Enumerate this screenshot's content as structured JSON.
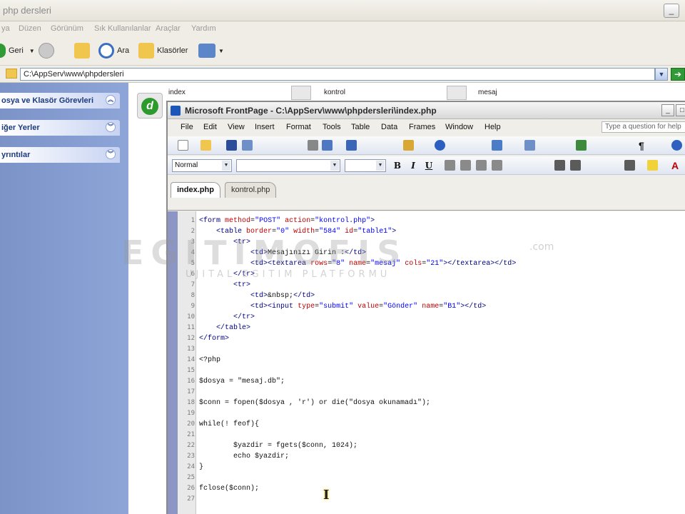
{
  "explorer": {
    "title": "php dersleri",
    "menu": [
      "ya",
      "Düzen",
      "Görünüm",
      "Sık Kullanılanlar",
      "Araçlar",
      "Yardım"
    ],
    "toolbar": {
      "back": "Geri",
      "search": "Ara",
      "folders": "Klasörler"
    },
    "address": "C:\\AppServ\\www\\phpdersleri",
    "left_panels": [
      "osya ve Klasör Görevleri",
      "iğer Yerler",
      "yrıntılar"
    ],
    "files": [
      "index",
      "kontrol",
      "mesaj"
    ]
  },
  "frontpage": {
    "title": "Microsoft FrontPage - C:\\AppServ\\www\\phpdersleri\\index.php",
    "menu": [
      "File",
      "Edit",
      "View",
      "Insert",
      "Format",
      "Tools",
      "Table",
      "Data",
      "Frames",
      "Window",
      "Help"
    ],
    "ask": "Type a question for help",
    "style_combo": "Normal",
    "format_buttons": [
      "B",
      "I",
      "U"
    ],
    "tabs": [
      "index.php",
      "kontrol.php"
    ],
    "code": [
      {
        "n": "1",
        "t": "<form method=\"POST\" action=\"kontrol.php\">"
      },
      {
        "n": "2",
        "t": "    <table border=\"0\" width=\"584\" id=\"table1\">"
      },
      {
        "n": "3",
        "t": "        <tr>"
      },
      {
        "n": "4",
        "t": "            <td>Mesajınızı Girin :</td>"
      },
      {
        "n": "5",
        "t": "            <td><textarea rows=\"8\" name=\"mesaj\" cols=\"21\"></textarea></td>"
      },
      {
        "n": "6",
        "t": "        </tr>"
      },
      {
        "n": "7",
        "t": "        <tr>"
      },
      {
        "n": "8",
        "t": "            <td>&nbsp;</td>"
      },
      {
        "n": "9",
        "t": "            <td><input type=\"submit\" value=\"Gönder\" name=\"B1\"></td>"
      },
      {
        "n": "10",
        "t": "        </tr>"
      },
      {
        "n": "11",
        "t": "    </table>"
      },
      {
        "n": "12",
        "t": "</form>"
      },
      {
        "n": "13",
        "t": ""
      },
      {
        "n": "14",
        "t": "<?php"
      },
      {
        "n": "15",
        "t": ""
      },
      {
        "n": "16",
        "t": "$dosya = \"mesaj.db\";"
      },
      {
        "n": "17",
        "t": ""
      },
      {
        "n": "18",
        "t": "$conn = fopen($dosya , 'r') or die(\"dosya okunamadı\");"
      },
      {
        "n": "19",
        "t": ""
      },
      {
        "n": "20",
        "t": "while(! feof){"
      },
      {
        "n": "21",
        "t": ""
      },
      {
        "n": "22",
        "t": "        $yazdir = fgets($conn, 1024);"
      },
      {
        "n": "23",
        "t": "        echo $yazdir;"
      },
      {
        "n": "24",
        "t": "}"
      },
      {
        "n": "25",
        "t": ""
      },
      {
        "n": "26",
        "t": "fclose($conn);"
      },
      {
        "n": "27",
        "t": ""
      }
    ]
  },
  "watermark": {
    "main": "EGITIMOFIS",
    "sub": "UJITAL EGITIM PLATFORMU",
    "com": ".com"
  },
  "colors": {
    "tag": "#000080",
    "attr": "#c00000",
    "value": "#0000ff"
  }
}
